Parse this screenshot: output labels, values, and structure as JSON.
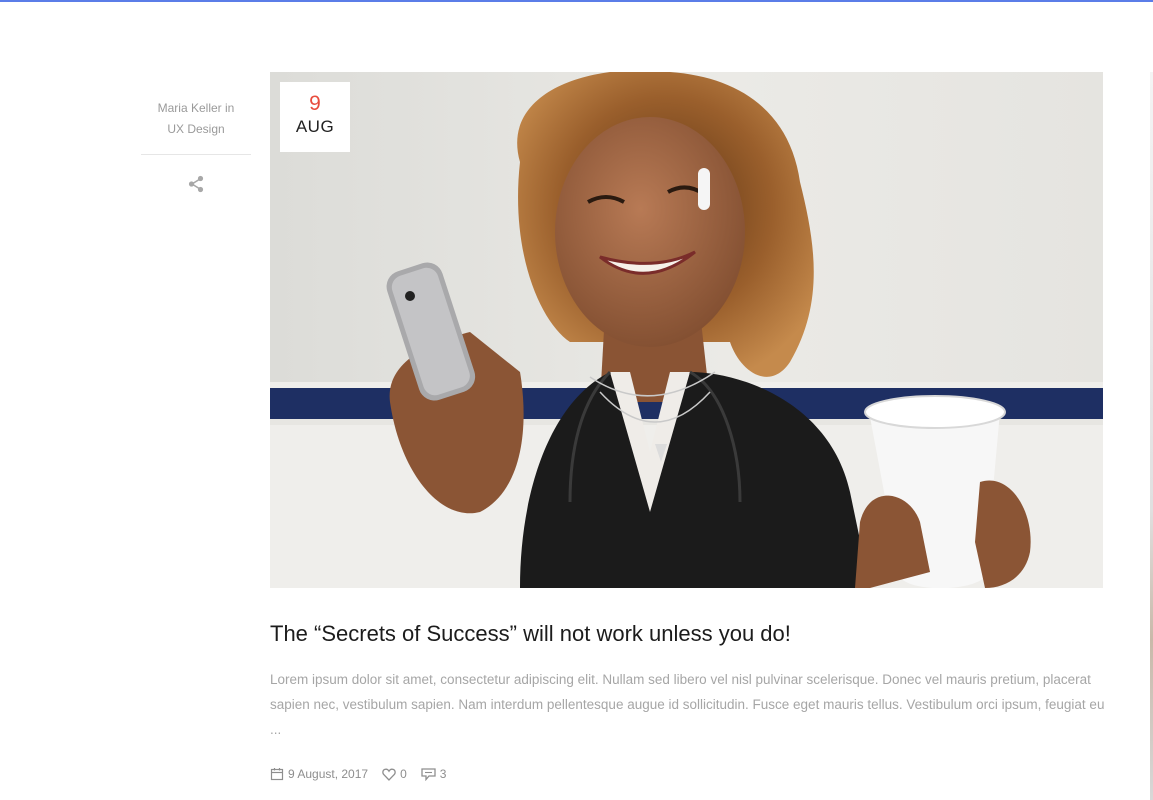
{
  "post": {
    "author": "Maria Keller",
    "author_in": "in",
    "category": "UX Design",
    "date_day": "9",
    "date_month": "AUG",
    "title": "The “Secrets of Success” will not work unless you do!",
    "excerpt": "Lorem ipsum dolor sit amet, consectetur adipiscing elit. Nullam sed libero vel nisl pulvinar scelerisque. Donec vel mauris pretium, placerat sapien nec, vestibulum sapien. Nam interdum pellentesque augue id sollicitudin. Fusce eget mauris tellus. Vestibulum orci ipsum, feugiat eu ...",
    "published": "9 August, 2017",
    "likes": "0",
    "comments": "3"
  },
  "icons": {
    "share": "share-icon",
    "calendar": "calendar-icon",
    "heart": "heart-icon",
    "comment": "comment-icon"
  },
  "colors": {
    "accent": "#e84c3d",
    "top_bar": "#5b7de8",
    "meta_text": "#9a9a9a"
  }
}
